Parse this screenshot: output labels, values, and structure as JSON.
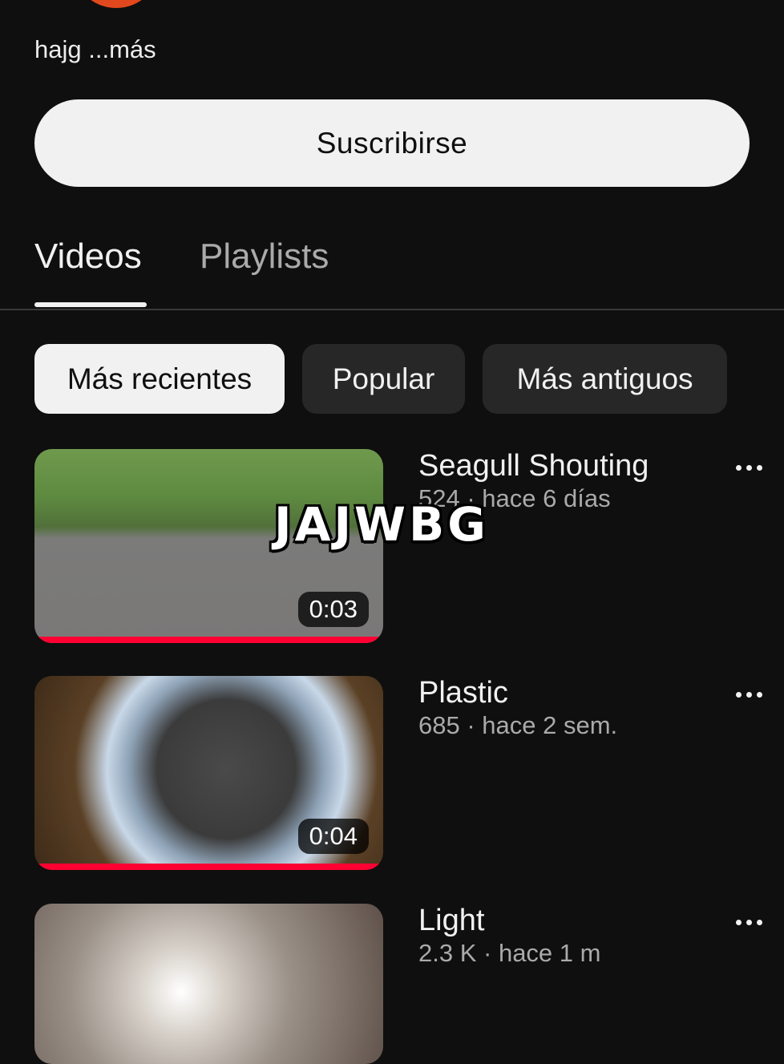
{
  "channel": {
    "description_text": "hajg ",
    "more_label": "...más",
    "subscribe_label": "Suscribirse"
  },
  "tabs": [
    {
      "label": "Videos",
      "selected": true
    },
    {
      "label": "Playlists",
      "selected": false
    }
  ],
  "filters": [
    {
      "label": "Más recientes",
      "selected": true
    },
    {
      "label": "Popular",
      "selected": false
    },
    {
      "label": "Más antiguos",
      "selected": false
    }
  ],
  "videos": [
    {
      "title": "Seagull Shouting",
      "views": "524",
      "age": "hace 6 días",
      "duration": "0:03",
      "watched_fraction": 1.0
    },
    {
      "title": "Plastic",
      "views": "685",
      "age": "hace 2 sem.",
      "duration": "0:04",
      "watched_fraction": 1.0
    },
    {
      "title": "Light",
      "views": "2.3 K",
      "age": "hace 1 m",
      "duration": "",
      "watched_fraction": 0
    }
  ],
  "overlay": {
    "watermark_text": "JAJWBG"
  },
  "colors": {
    "background": "#0f0f0f",
    "progress": "#ff0033",
    "chip_selected": "#f1f1f1",
    "chip": "#272727"
  }
}
